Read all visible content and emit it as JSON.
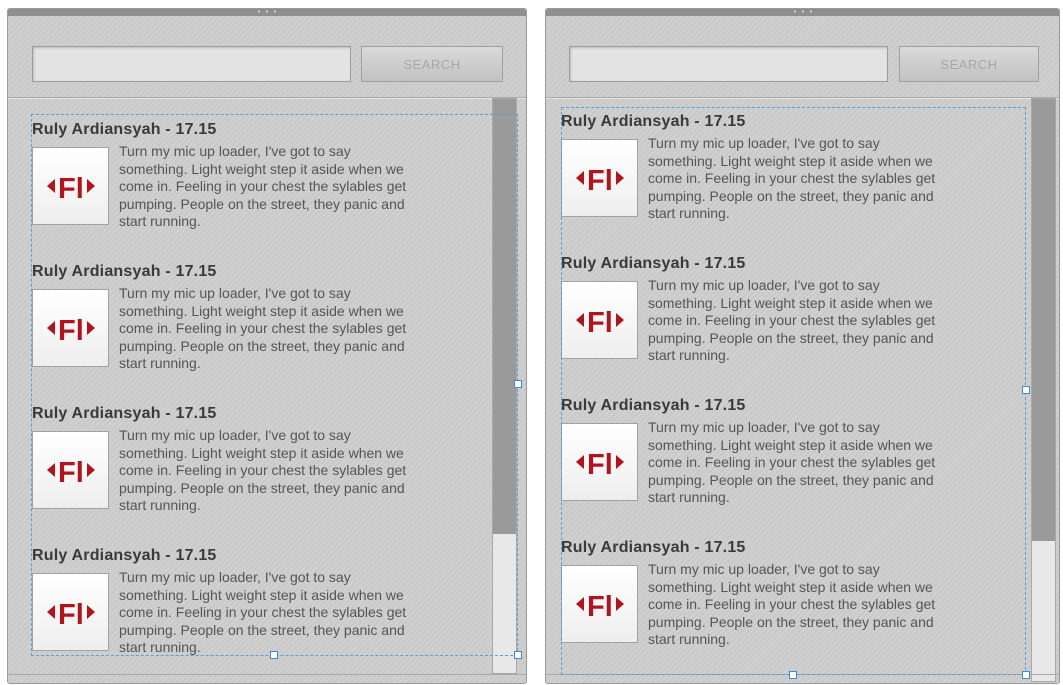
{
  "colors": {
    "panel_bg": "#cdcdcd",
    "scrollbar_thumb": "#9a9a9a",
    "selection": "#5aa0d6",
    "logo_red": "#b0141c"
  },
  "icons": {
    "grip": "grip-dots-icon",
    "thumbnail": "flash-fl-logo-icon"
  },
  "left_panel": {
    "search": {
      "button_label": "SEARCH",
      "input_value": "",
      "placeholder": ""
    },
    "scroll_position": 0.0,
    "items": [
      {
        "title": "Ruly Ardiansyah - 17.15",
        "lines": [
          "Turn my mic up loader, I've got to say",
          "something. Light weight step it aside when we",
          "come in. Feeling in your chest the sylables get",
          "pumping. People on the street, they panic and",
          "start running."
        ]
      },
      {
        "title": "Ruly Ardiansyah - 17.15",
        "lines": [
          "Turn my mic up loader, I've got to say",
          "something. Light weight step it aside when we",
          "come in. Feeling in your chest the sylables get",
          "pumping. People on the street, they panic and",
          "start running."
        ]
      },
      {
        "title": "Ruly Ardiansyah - 17.15",
        "lines": [
          "Turn my mic up loader, I've got to say",
          "something. Light weight step it aside when we",
          "come in. Feeling in your chest the sylables get",
          "pumping. People on the street, they panic and",
          "start running."
        ]
      },
      {
        "title": "Ruly Ardiansyah - 17.15",
        "lines": [
          "Turn my mic up loader, I've got to say",
          "something. Light weight step it aside when we",
          "come in. Feeling in your chest the sylables get",
          "pumping. People on the street, they panic and",
          "start running."
        ]
      }
    ]
  },
  "right_panel": {
    "search": {
      "button_label": "SEARCH",
      "input_value": "",
      "placeholder": ""
    },
    "scroll_position": 1.0,
    "items": [
      {
        "title": "Ruly Ardiansyah - 17.15",
        "lines": [
          "Turn my mic up loader, I've got to say",
          "something. Light weight step it aside when we",
          "come in. Feeling in your chest the sylables get",
          "pumping. People on the street, they panic and",
          "start running."
        ]
      },
      {
        "title": "Ruly Ardiansyah - 17.15",
        "lines": [
          "Turn my mic up loader, I've got to say",
          "something. Light weight step it aside when we",
          "come in. Feeling in your chest the sylables get",
          "pumping. People on the street, they panic and",
          "start running."
        ]
      },
      {
        "title": "Ruly Ardiansyah - 17.15",
        "lines": [
          "Turn my mic up loader, I've got to say",
          "something. Light weight step it aside when we",
          "come in. Feeling in your chest the sylables get",
          "pumping. People on the street, they panic and",
          "start running."
        ]
      },
      {
        "title": "Ruly Ardiansyah - 17.15",
        "lines": [
          "Turn my mic up loader, I've got to say",
          "something. Light weight step it aside when we",
          "come in. Feeling in your chest the sylables get",
          "pumping. People on the street, they panic and",
          "start running."
        ]
      }
    ]
  }
}
